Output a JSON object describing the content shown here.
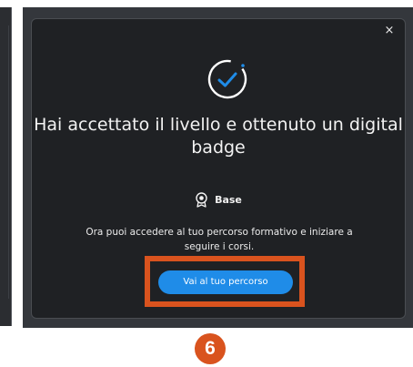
{
  "dialog": {
    "close_label": "×",
    "title": "Hai accettato il livello e ottenuto un digital badge",
    "badge_level": "Base",
    "description": "Ora puoi accedere al tuo percorso formativo e iniziare a seguire i corsi.",
    "cta_label": "Vai al tuo percorso"
  },
  "step": {
    "number": "6"
  },
  "colors": {
    "accent_blue": "#1f8ce8",
    "highlight_orange": "#d9531e",
    "dialog_bg": "#1f2124"
  },
  "icons": {
    "success": "check-circle-icon",
    "badge": "medal-icon",
    "close": "close-icon"
  }
}
